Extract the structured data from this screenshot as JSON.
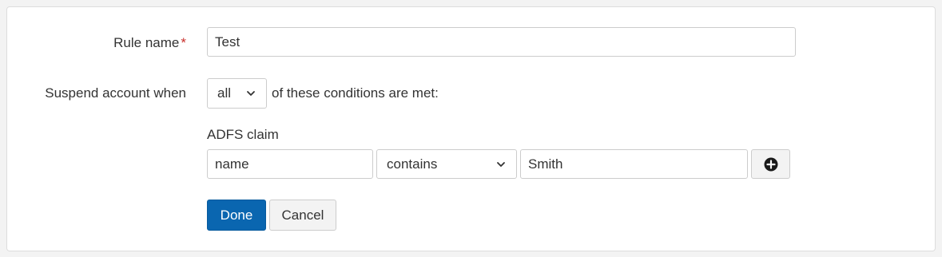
{
  "form": {
    "rule_name": {
      "label": "Rule name",
      "required_marker": "*",
      "value": "Test"
    },
    "suspend": {
      "label": "Suspend account when",
      "match_value": "all",
      "suffix": "of these conditions are met:"
    },
    "condition": {
      "section_label": "ADFS claim",
      "claim_value": "name",
      "operator_value": "contains",
      "match_text": "Smith",
      "add_icon": "plus-circle-icon"
    },
    "actions": {
      "done_label": "Done",
      "cancel_label": "Cancel"
    }
  },
  "colors": {
    "primary": "#0a66b0",
    "required": "#c9302c",
    "border": "#cccccc",
    "background": "#f3f3f3"
  }
}
